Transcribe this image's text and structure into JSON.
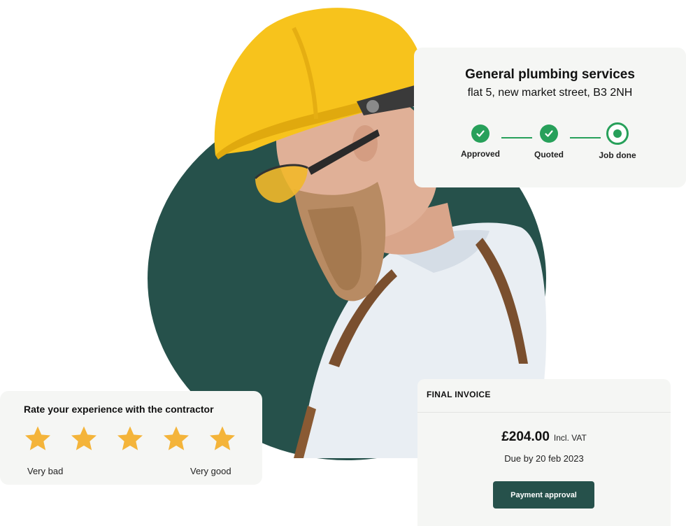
{
  "job": {
    "title": "General plumbing services",
    "address": "flat 5, new market street, B3 2NH",
    "steps": [
      {
        "label": "Approved",
        "status": "done"
      },
      {
        "label": "Quoted",
        "status": "done"
      },
      {
        "label": "Job done",
        "status": "current"
      }
    ]
  },
  "rating": {
    "title": "Rate your experience with the contractor",
    "stars": 5,
    "min_label": "Very bad",
    "max_label": "Very good"
  },
  "invoice": {
    "header": "FINAL INVOICE",
    "amount": "£204.00",
    "vat_note": "Incl. VAT",
    "due": "Due by 20 feb 2023",
    "button_label": "Payment approval"
  },
  "colors": {
    "brand_dark_green": "#26514b",
    "success_green": "#27a05a",
    "star_gold": "#f4b43a",
    "card_bg": "#f5f6f4",
    "helmet_yellow": "#f7c31c"
  },
  "icons": {
    "step_done": "check-circle-icon",
    "step_current": "radio-dot-icon",
    "rating": "star-icon"
  }
}
